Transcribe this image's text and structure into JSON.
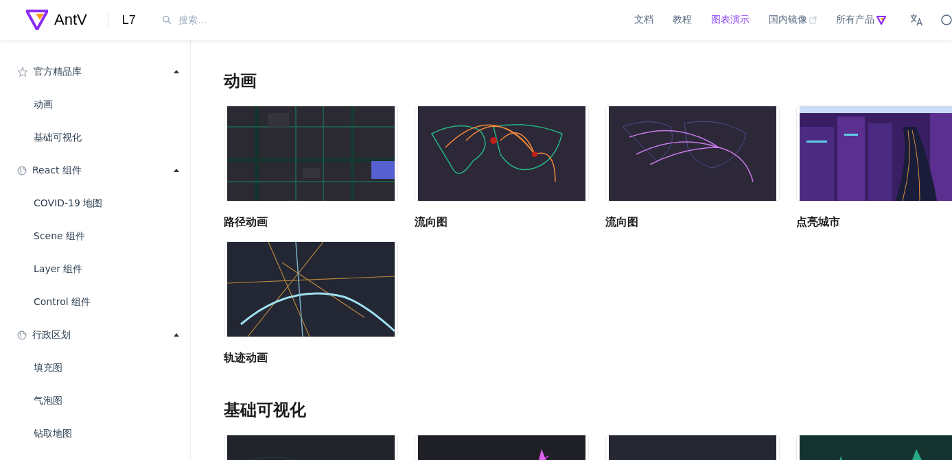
{
  "header": {
    "brand": "AntV",
    "product": "L7",
    "search": {
      "placeholder": "搜索…"
    },
    "nav": [
      {
        "label": "文档",
        "selected": false,
        "kind": "plain"
      },
      {
        "label": "教程",
        "selected": false,
        "kind": "plain"
      },
      {
        "label": "图表演示",
        "selected": true,
        "kind": "plain"
      },
      {
        "label": "国内镜像",
        "selected": false,
        "kind": "external"
      },
      {
        "label": "所有产品",
        "selected": false,
        "kind": "products"
      }
    ]
  },
  "sidebar": {
    "groups": [
      {
        "label": "官方精品库",
        "kind": "star",
        "expanded": true,
        "children": [
          {
            "label": "动画"
          },
          {
            "label": "基础可视化"
          }
        ]
      },
      {
        "label": "React 组件",
        "kind": "globe",
        "expanded": true,
        "children": [
          {
            "label": "COVID-19 地图"
          },
          {
            "label": "Scene 组件"
          },
          {
            "label": "Layer 组件"
          },
          {
            "label": "Control 组件"
          }
        ]
      },
      {
        "label": "行政区划",
        "kind": "globe",
        "expanded": true,
        "children": [
          {
            "label": "填充图"
          },
          {
            "label": "气泡图"
          },
          {
            "label": "钻取地图"
          }
        ]
      }
    ]
  },
  "sections": [
    {
      "title": "动画",
      "cards": [
        {
          "title": "路径动画",
          "kind": "streets"
        },
        {
          "title": "流向图",
          "kind": "flow-red"
        },
        {
          "title": "流向图",
          "kind": "flow-purple"
        },
        {
          "title": "点亮城市",
          "kind": "city"
        },
        {
          "title": "轨迹动画",
          "kind": "trails"
        }
      ]
    },
    {
      "title": "基础可视化",
      "cards": [
        {
          "kind": "wind"
        },
        {
          "kind": "flow-magenta"
        },
        {
          "kind": "outline"
        },
        {
          "kind": "terrain"
        }
      ]
    }
  ]
}
